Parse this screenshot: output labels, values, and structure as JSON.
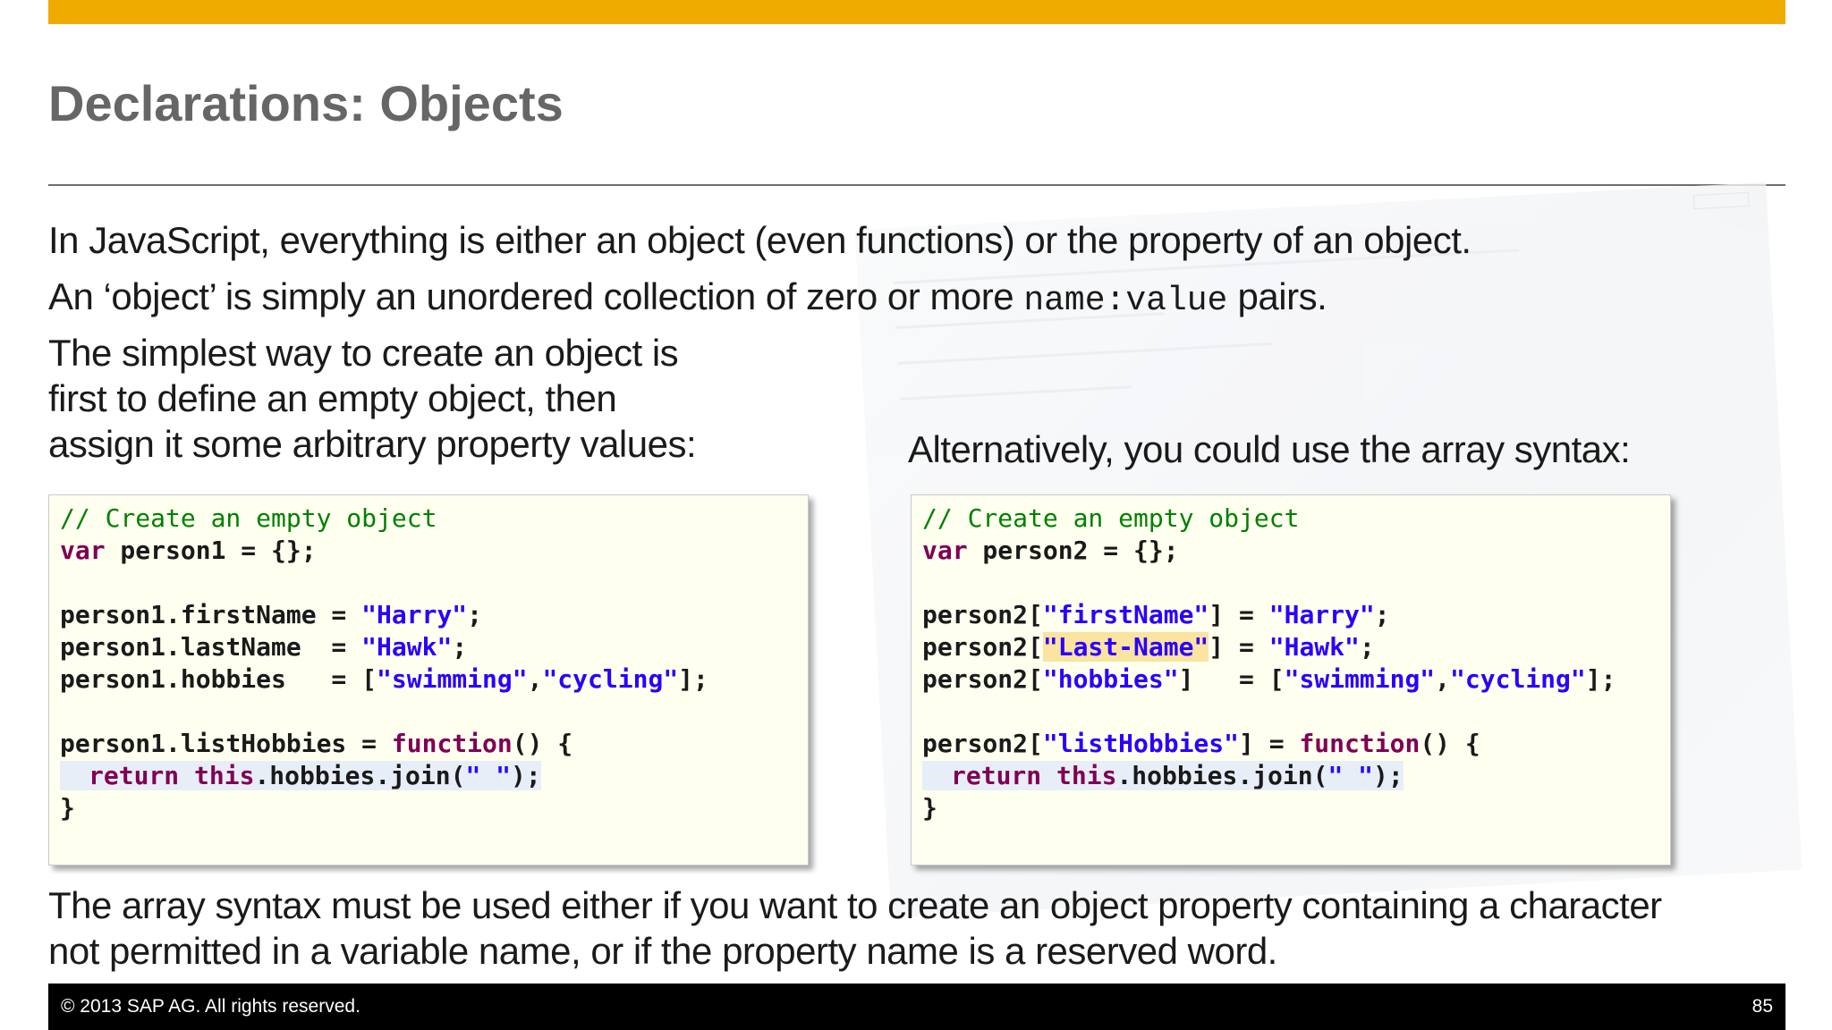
{
  "slide": {
    "title": "Declarations: Objects",
    "para1": "In JavaScript, everything is either an object (even functions) or the property of an object.",
    "para2_pre": "An ‘object’ is simply an unordered collection of zero or more ",
    "para2_code": "name:value",
    "para2_post": " pairs.",
    "left_intro": [
      "The simplest way to create an object is",
      "first to define an empty object, then",
      "assign it some arbitrary property values:"
    ],
    "right_intro": "Alternatively, you could use the array syntax:",
    "conclusion": [
      "The array syntax must be used either if you want to create an object property containing a character",
      "not permitted in a variable name, or if the property name is a reserved word."
    ]
  },
  "code_left": {
    "comment": "// Create an empty object",
    "decl_kw": "var",
    "decl_rest": " person1 = {};",
    "l3_a": "person1.firstName = ",
    "l3_s": "\"Harry\"",
    "l3_e": ";",
    "l4_a": "person1.lastName  = ",
    "l4_s": "\"Hawk\"",
    "l4_e": ";",
    "l5_a": "person1.hobbies   = [",
    "l5_s1": "\"swimming\"",
    "l5_c": ",",
    "l5_s2": "\"cycling\"",
    "l5_e": "];",
    "l7_a": "person1.listHobbies = ",
    "l7_kw": "function",
    "l7_e": "() {",
    "l8_kw1": "return",
    "l8_sp": " ",
    "l8_kw2": "this",
    "l8_mid": ".hobbies.join(",
    "l8_s": "\" \"",
    "l8_e": ");",
    "l9": "}"
  },
  "code_right": {
    "comment": "// Create an empty object",
    "decl_kw": "var",
    "decl_rest": " person2 = {};",
    "l3_a": "person2[",
    "l3_k": "\"firstName\"",
    "l3_b": "] = ",
    "l3_s": "\"Harry\"",
    "l3_e": ";",
    "l4_a": "person2[",
    "l4_k": "\"Last-Name\"",
    "l4_b": "] = ",
    "l4_s": "\"Hawk\"",
    "l4_e": ";",
    "l5_a": "person2[",
    "l5_k": "\"hobbies\"",
    "l5_b": "]   = [",
    "l5_s1": "\"swimming\"",
    "l5_c": ",",
    "l5_s2": "\"cycling\"",
    "l5_e": "];",
    "l7_a": "person2[",
    "l7_k": "\"listHobbies\"",
    "l7_b": "] = ",
    "l7_kw": "function",
    "l7_e": "() {",
    "l8_kw1": "return",
    "l8_sp": " ",
    "l8_kw2": "this",
    "l8_mid": ".hobbies.join(",
    "l8_s": "\" \"",
    "l8_e": ");",
    "l9": "}"
  },
  "footer": {
    "copyright": "©  2013 SAP AG. All rights reserved.",
    "page_number": "85"
  },
  "colors": {
    "accent_bar": "#f0ab00",
    "title": "#666666",
    "code_background": "#ffffef",
    "comment": "#008000",
    "keyword": "#7f0055",
    "string": "#2a00ff",
    "highlight": "#fbe3a0"
  }
}
